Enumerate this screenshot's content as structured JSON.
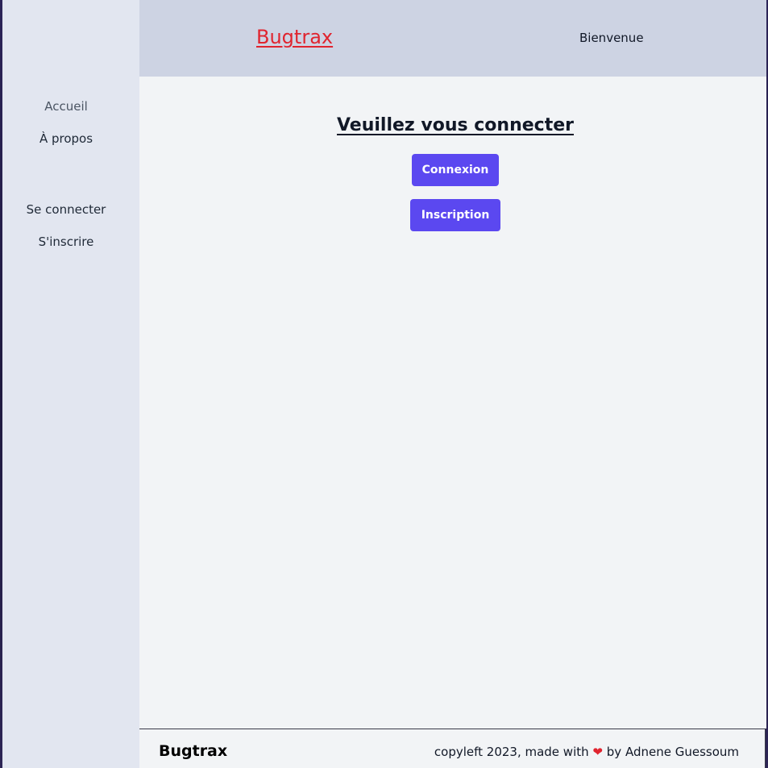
{
  "nav": {
    "home": "Accueil",
    "about": "À propos",
    "login": "Se connecter",
    "signup": "S'inscrire"
  },
  "header": {
    "brand": "Bugtrax",
    "welcome": "Bienvenue"
  },
  "main": {
    "title": "Veuillez vous connecter",
    "login_button": "Connexion",
    "register_button": "Inscription"
  },
  "footer": {
    "brand": "Bugtrax",
    "credit_prefix": "copyleft 2023, made with",
    "heart": "❤",
    "credit_suffix": "by Adnene Guessoum"
  },
  "colors": {
    "accent": "#5b48f0",
    "brand": "#e0242f",
    "sidebar": "#e2e6f0",
    "header": "#cdd3e3",
    "content": "#f2f4f6"
  }
}
